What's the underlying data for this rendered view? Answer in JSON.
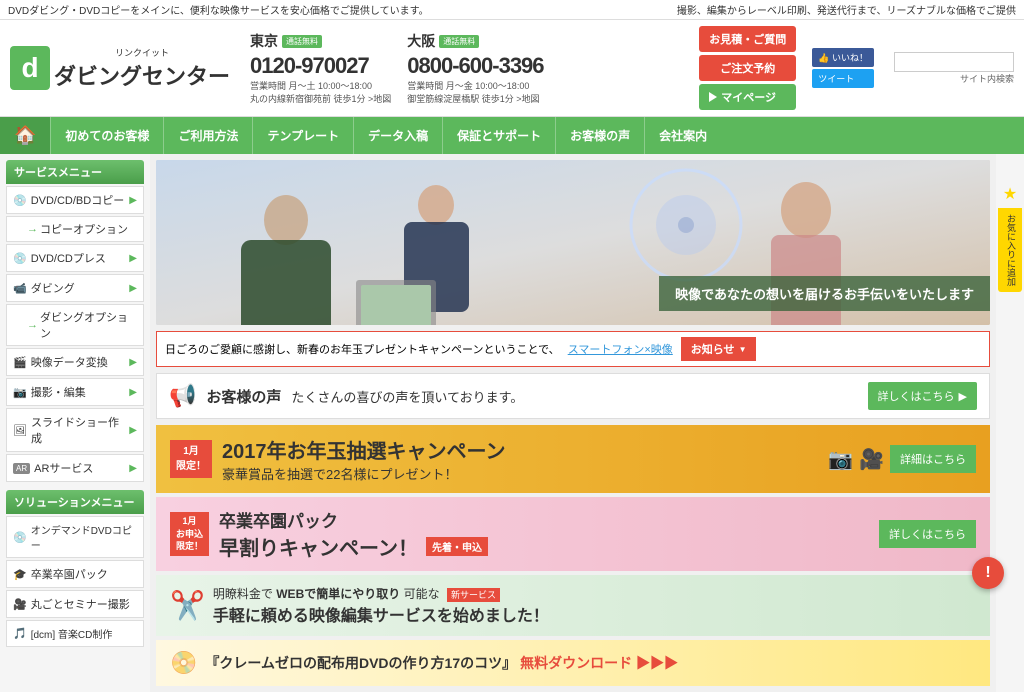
{
  "topbar": {
    "text": "DVDダビング・DVDコピーをメインに、便利な映像サービスを安心価格でご提供しています。",
    "right_text": "撮影、編集からレーベル印刷、発送代行まで、リーズナブルな価格でご提供"
  },
  "header": {
    "logo": {
      "char": "d",
      "ruby": "リンクイット",
      "name": "ダビングセンター"
    },
    "tokyo": {
      "city": "東京",
      "free_label": "通話無料",
      "number": "0120-970027",
      "hours": "営業時間 月〜土 10:00〜18:00",
      "address": "丸の内線新宿御苑前 徒歩1分 >地図"
    },
    "osaka": {
      "city": "大阪",
      "free_label": "通話無料",
      "number": "0800-600-3396",
      "hours": "営業時間 月〜金 10:00〜18:00",
      "address": "御堂筋線淀屋橋駅 徒歩1分 >地図"
    },
    "buttons": {
      "mitsumori": "お見積・ご質問",
      "chyumon": "ご注文予約",
      "mypage": "マイページ"
    },
    "social": {
      "iine": "👍 いいね！",
      "tweet": "ツイート"
    },
    "search": {
      "placeholder": "",
      "label": "サイト内検索"
    }
  },
  "nav": {
    "home_icon": "🏠",
    "items": [
      "初めてのお客様",
      "ご利用方法",
      "テンプレート",
      "データ入稿",
      "保証とサポート",
      "お客様の声",
      "会社案内"
    ]
  },
  "sidebar": {
    "service_menu_title": "サービスメニュー",
    "service_items": [
      {
        "label": "DVD/CD/BDコピー",
        "icon": "💿",
        "has_arrow": true
      },
      {
        "label": "コピーオプション",
        "icon": "",
        "has_arrow": true,
        "is_sub": true
      },
      {
        "label": "DVD/CDプレス",
        "icon": "💿",
        "has_arrow": true
      },
      {
        "label": "ダビング",
        "icon": "📹",
        "has_arrow": true
      },
      {
        "label": "ダビングオプション",
        "icon": "",
        "has_arrow": true,
        "is_sub": true
      },
      {
        "label": "映像データ変換",
        "icon": "🎬",
        "has_arrow": true
      },
      {
        "label": "撮影・編集",
        "icon": "📷",
        "has_arrow": true
      },
      {
        "label": "スライドショー作成",
        "icon": "🖼",
        "has_arrow": true
      },
      {
        "label": "ARサービス",
        "icon": "AR",
        "has_arrow": true
      }
    ],
    "solution_menu_title": "ソリューションメニュー",
    "solution_items": [
      {
        "label": "オンデマンドDVDコピー",
        "icon": "💿"
      },
      {
        "label": "卒業卒園パック",
        "icon": "🎓"
      },
      {
        "label": "丸ごとセミナー撮影",
        "icon": "🎥"
      },
      {
        "label": "[dcm] 音楽CD制作",
        "icon": "🎵"
      }
    ]
  },
  "hero": {
    "text": "映像であなたの想いを届けるお手伝いをいたします"
  },
  "campaign_bar": {
    "text": "日ごろのご愛顧に感謝し、新春のお年玉プレゼントキャンペーンということで、",
    "link": "スマートフォン×映像",
    "button": "お知らせ"
  },
  "voice_bar": {
    "label": "お客様の声",
    "text": "たくさんの喜びの声を頂いております。",
    "button": "詳しくはこちら"
  },
  "banners": {
    "banner1": {
      "month_badge": "1月\n限定！",
      "title": "2017年お年玉抽選キャンペーン",
      "subtitle": "豪華賞品を抽選で22名様にプレゼント！",
      "button": "詳細はこちら"
    },
    "banner2": {
      "month_badge": "1月\nお申込\n限定！",
      "title": "卒業卒園パック",
      "subtitle": "早割りキャンペーン！",
      "badge": "先着・申込",
      "button": "詳しくはこちら"
    },
    "banner3": {
      "prefix": "明瞭料金で",
      "highlight1": "WEBで簡単にやり取り",
      "suffix1": "可能な",
      "badge": "新サービス",
      "subtitle": "手軽に頼める映像編集サービスを始めました！"
    },
    "banner4": {
      "title": "『クレームゼロの配布用DVDの作り方17のコツ』",
      "suffix": "無料ダウンロード ▶▶▶"
    }
  },
  "right_sidebar": {
    "star": "★",
    "label": "お気に入りに追加"
  },
  "alert_button": "!"
}
